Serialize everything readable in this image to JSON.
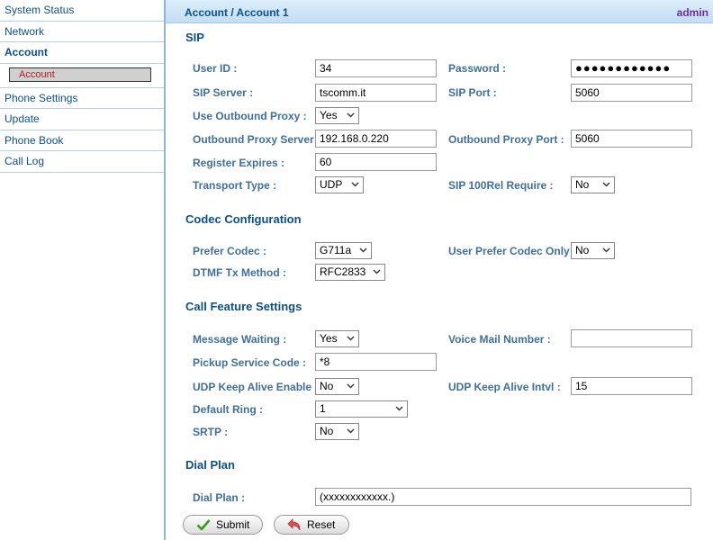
{
  "sidebar": {
    "items": [
      {
        "label": "System Status"
      },
      {
        "label": "Network"
      },
      {
        "label": "Account"
      },
      {
        "label": "Phone Settings"
      },
      {
        "label": "Update"
      },
      {
        "label": "Phone Book"
      },
      {
        "label": "Call Log"
      }
    ],
    "sub_item": "Account"
  },
  "header": {
    "breadcrumb": "Account / Account 1",
    "user": "admin"
  },
  "sections": {
    "sip": "SIP",
    "codec": "Codec Configuration",
    "call_feature": "Call Feature Settings",
    "dial_plan": "Dial Plan"
  },
  "fields": {
    "user_id": {
      "label": "User ID :",
      "value": "34"
    },
    "password": {
      "label": "Password :",
      "value": "●●●●●●●●●●●●"
    },
    "sip_server": {
      "label": "SIP Server :",
      "value": "tscomm.it"
    },
    "sip_port": {
      "label": "SIP Port :",
      "value": "5060"
    },
    "use_outbound_proxy": {
      "label": "Use Outbound Proxy :",
      "value": "Yes"
    },
    "outbound_proxy_server": {
      "label": "Outbound Proxy Server :",
      "value": "192.168.0.220"
    },
    "outbound_proxy_port": {
      "label": "Outbound Proxy Port :",
      "value": "5060"
    },
    "register_expires": {
      "label": "Register Expires :",
      "value": "60"
    },
    "transport_type": {
      "label": "Transport Type :",
      "value": "UDP"
    },
    "sip_100rel": {
      "label": "SIP 100Rel Require :",
      "value": "No"
    },
    "prefer_codec": {
      "label": "Prefer Codec :",
      "value": "G711a"
    },
    "user_prefer_codec_only": {
      "label": "User Prefer Codec Only :",
      "value": "No"
    },
    "dtmf_tx_method": {
      "label": "DTMF Tx Method :",
      "value": "RFC2833"
    },
    "message_waiting": {
      "label": "Message Waiting :",
      "value": "Yes"
    },
    "voice_mail_number": {
      "label": "Voice Mail Number :",
      "value": ""
    },
    "pickup_service_code": {
      "label": "Pickup Service Code :",
      "value": "*8"
    },
    "udp_keep_alive_enable": {
      "label": "UDP Keep Alive Enable :",
      "value": "No"
    },
    "udp_keep_alive_intvl": {
      "label": "UDP Keep Alive Intvl :",
      "value": "15"
    },
    "default_ring": {
      "label": "Default Ring :",
      "value": "1"
    },
    "srtp": {
      "label": "SRTP :",
      "value": "No"
    },
    "dial_plan": {
      "label": "Dial Plan :",
      "value": "(xxxxxxxxxxxx.)"
    }
  },
  "buttons": {
    "submit": "Submit",
    "reset": "Reset"
  },
  "icons": {
    "submit": "checkmark-icon",
    "reset": "undo-arrow-icon"
  },
  "colors": {
    "nav_text": "#0b4f8e",
    "label_text": "#3f6f9c",
    "admin": "#6b2fa0",
    "sub_item_text": "#b02020"
  }
}
